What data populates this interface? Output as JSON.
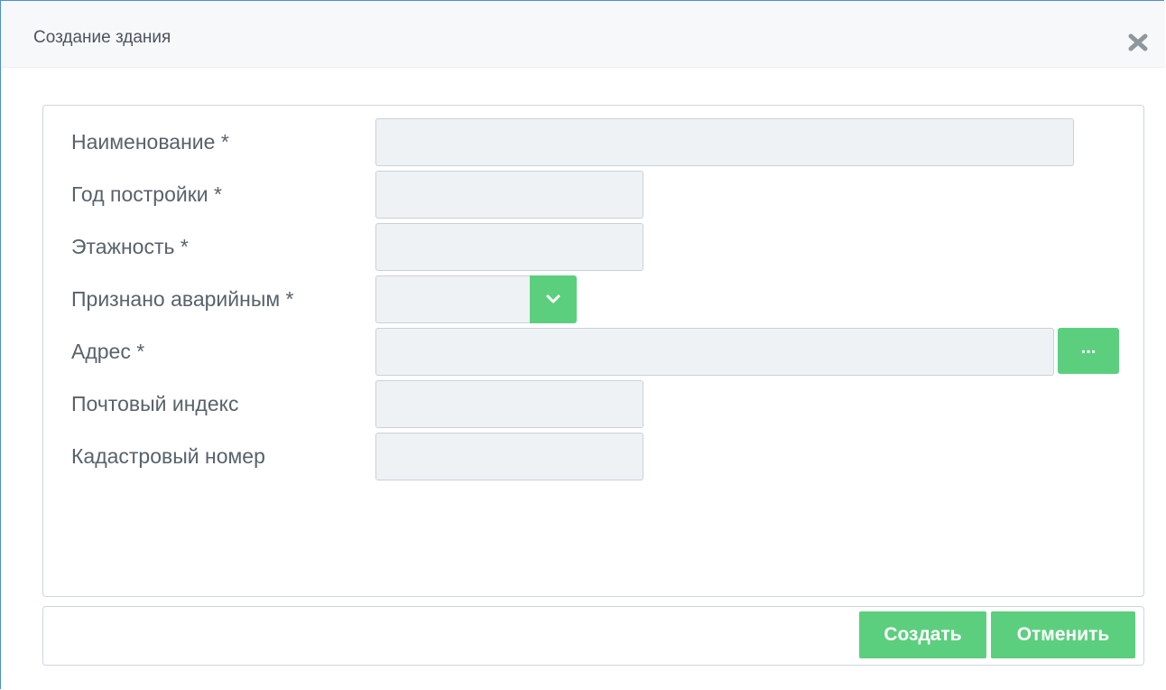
{
  "dialog": {
    "title": "Создание здания",
    "close_icon": "close-icon"
  },
  "form": {
    "fields": [
      {
        "label": "Наименование *",
        "value": "",
        "type": "text"
      },
      {
        "label": "Год постройки *",
        "value": "",
        "type": "text"
      },
      {
        "label": "Этажность *",
        "value": "",
        "type": "text"
      },
      {
        "label": "Признано аварийным *",
        "value": "",
        "type": "select"
      },
      {
        "label": "Адрес *",
        "value": "",
        "type": "text-with-picker"
      },
      {
        "label": "Почтовый индекс",
        "value": "",
        "type": "text"
      },
      {
        "label": "Кадастровый номер",
        "value": "",
        "type": "text"
      }
    ],
    "address_picker_label": "...",
    "dropdown_icon": "chevron-down-icon"
  },
  "footer": {
    "create_label": "Создать",
    "cancel_label": "Отменить"
  },
  "colors": {
    "accent": "#5ccf7e",
    "input_bg": "#eef2f5",
    "border": "#cdd6de",
    "window_border": "#4d8fd6"
  }
}
